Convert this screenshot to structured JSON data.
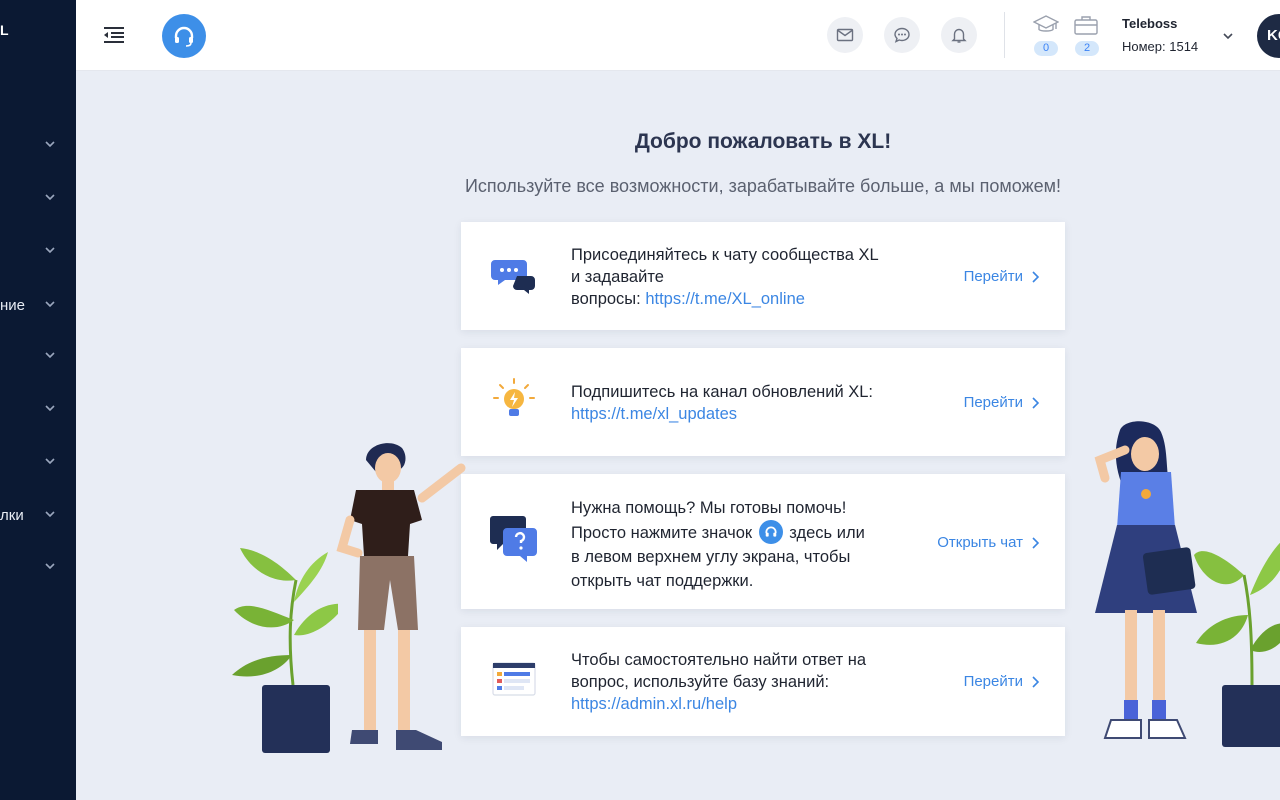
{
  "sidebar": {
    "logo": "L",
    "items": [
      {
        "label": ""
      },
      {
        "label": ""
      },
      {
        "label": ""
      },
      {
        "label": "ние"
      },
      {
        "label": ""
      },
      {
        "label": ""
      },
      {
        "label": ""
      },
      {
        "label": "лки"
      },
      {
        "label": ""
      }
    ]
  },
  "header": {
    "counters": [
      {
        "icon": "graduation-cap-icon",
        "value": "0"
      },
      {
        "icon": "briefcase-icon",
        "value": "2"
      }
    ],
    "account": {
      "name": "Teleboss",
      "number": "Номер: 1514"
    },
    "avatar": "KC"
  },
  "main": {
    "title": "Добро пожаловать в XL!",
    "subtitle": "Используйте все возможности, зарабатывайте больше, а мы поможем!",
    "cards": [
      {
        "icon": "chat-bubbles-icon",
        "line1": "Присоединяйтесь к чату сообщества XL",
        "line2": "и задавайте",
        "line3": "вопросы: ",
        "link": "https://t.me/XL_online",
        "action": "Перейти"
      },
      {
        "icon": "lightbulb-icon",
        "line1": "Подпишитесь на канал обновлений XL:",
        "link": "https://t.me/xl_updates",
        "action": "Перейти"
      },
      {
        "icon": "question-chat-icon",
        "line1": "Нужна помощь? Мы готовы помочь!",
        "line2a": "Просто нажмите значок",
        "line2b": "здесь или",
        "line3": "в левом верхнем углу экрана, чтобы",
        "line4": "открыть чат поддержки.",
        "action": "Открыть чат"
      },
      {
        "icon": "knowledge-base-icon",
        "line1": "Чтобы самостоятельно найти ответ на",
        "line2": "вопрос, используйте базу знаний:",
        "link": "https://admin.xl.ru/help",
        "action": "Перейти"
      }
    ]
  },
  "colors": {
    "sidebar": "#0b1933",
    "accent": "#3d8fe8",
    "link": "#3b86e3",
    "background": "#e9edf5"
  }
}
